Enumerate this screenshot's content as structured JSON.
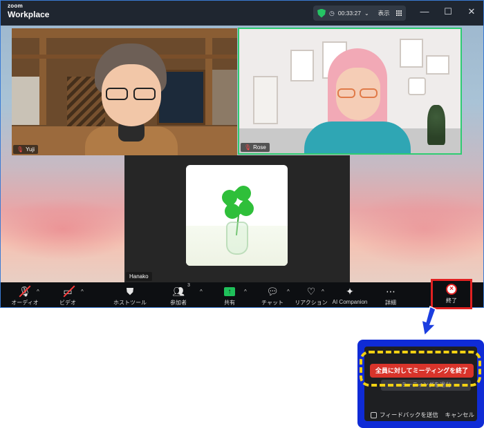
{
  "window": {
    "brand_small": "zoom",
    "brand_big": "Workplace",
    "timer": "00:33:27",
    "view_label": "表示",
    "controls": {
      "minimize": "—",
      "maximize": "☐",
      "close": "✕"
    }
  },
  "participants": [
    {
      "name": "Yuji",
      "muted": true
    },
    {
      "name": "Rose",
      "muted": true,
      "active_speaker": true
    },
    {
      "name": "Hanako",
      "muted": false
    }
  ],
  "toolbar": {
    "audio": "オーディオ",
    "video": "ビデオ",
    "host_tools": "ホストツール",
    "participants": "参加者",
    "participants_count": "3",
    "share": "共有",
    "chat": "チャット",
    "reactions": "リアクション",
    "ai_companion": "AI Companion",
    "more": "詳細",
    "end": "終了"
  },
  "end_popup": {
    "end_for_all": "全員に対してミーティングを終了",
    "leave_meeting": "ミーティングを退出",
    "feedback": "フィードバックを送信",
    "cancel": "キャンセル"
  },
  "colors": {
    "titlebar": "#1f2630",
    "toolbar": "#0d0f12",
    "end_red": "#d9342b",
    "highlight_yellow": "#f2d113",
    "highlight_blue": "#0f2bd6",
    "active_speaker_green": "#2ecc71",
    "share_green": "#1fc05a"
  }
}
